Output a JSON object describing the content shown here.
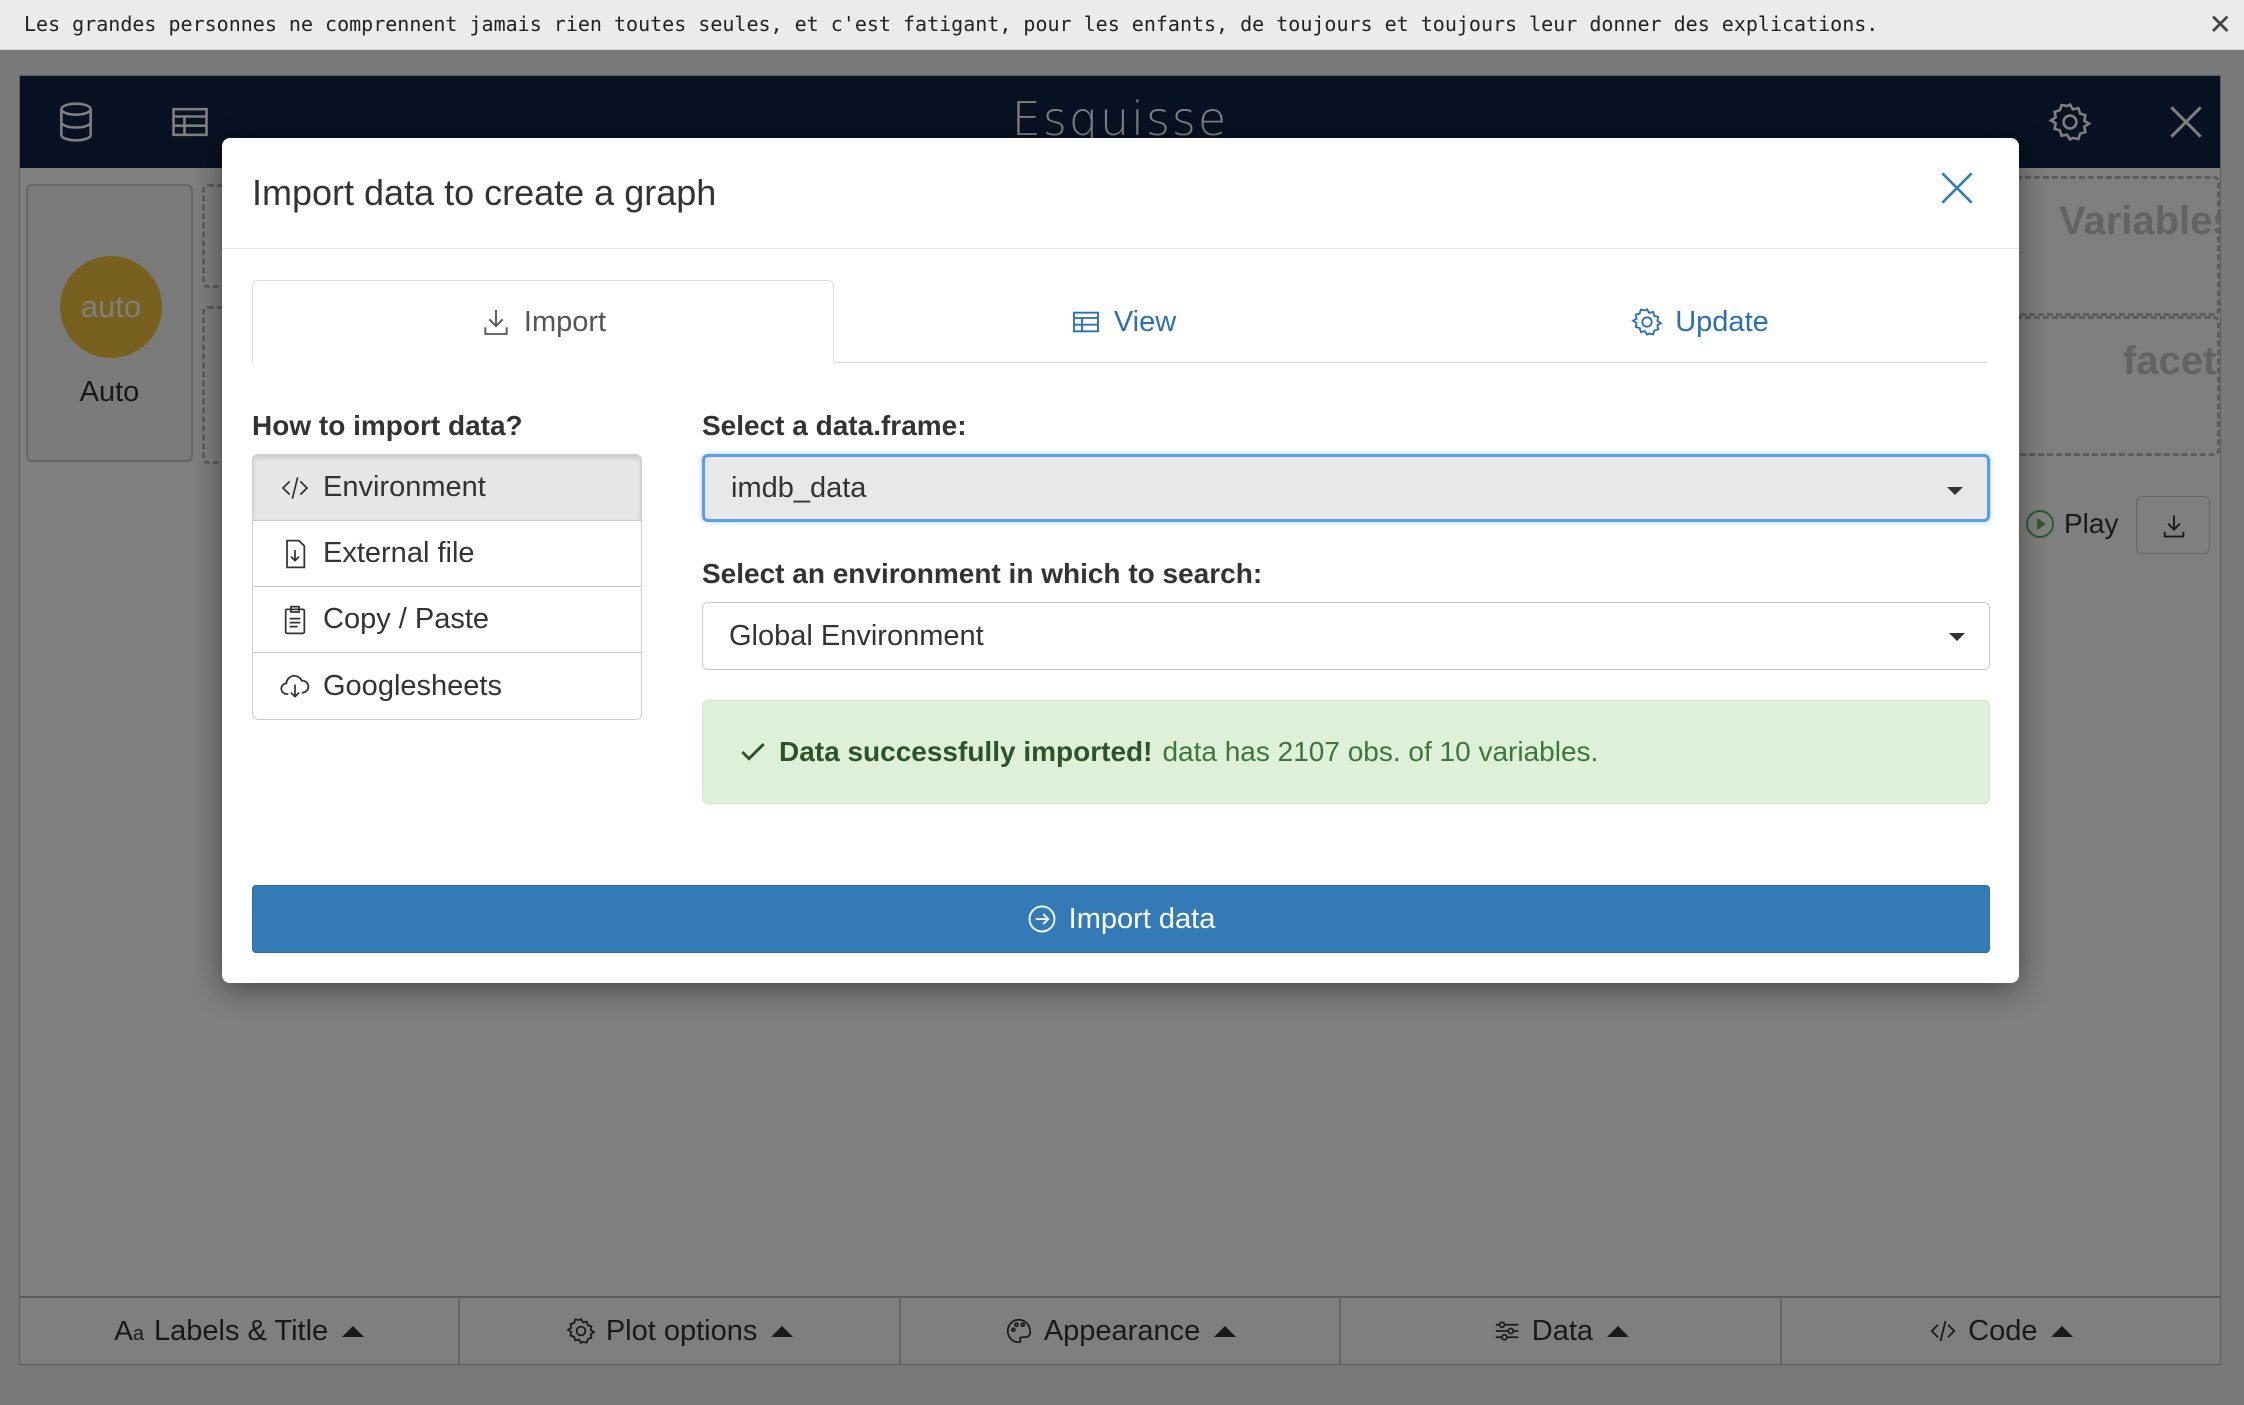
{
  "notice": {
    "text": "Les grandes personnes ne comprennent jamais rien toutes seules, et c'est fatigant, pour les enfants, de toujours et toujours leur donner des explications.",
    "close_glyph": "✕"
  },
  "app": {
    "title": "Esquisse",
    "geom_auto": {
      "circle": "auto",
      "label": "Auto"
    },
    "dropzones": {
      "variables": "Variables",
      "facet": "facet"
    },
    "play_label": "Play",
    "bottom_nav": [
      {
        "label": "Labels & Title",
        "icon": "font-icon"
      },
      {
        "label": "Plot options",
        "icon": "gear-icon"
      },
      {
        "label": "Appearance",
        "icon": "palette-icon"
      },
      {
        "label": "Data",
        "icon": "sliders-icon"
      },
      {
        "label": "Code",
        "icon": "code-icon"
      }
    ]
  },
  "modal": {
    "title": "Import data to create a graph",
    "tabs": [
      {
        "label": "Import",
        "active": true
      },
      {
        "label": "View",
        "active": false
      },
      {
        "label": "Update",
        "active": false
      }
    ],
    "how_label": "How to import data?",
    "methods": [
      {
        "label": "Environment",
        "active": true
      },
      {
        "label": "External file",
        "active": false
      },
      {
        "label": "Copy / Paste",
        "active": false
      },
      {
        "label": "Googlesheets",
        "active": false
      }
    ],
    "dataframe_label": "Select a data.frame:",
    "dataframe_value": "imdb_data",
    "env_label": "Select an environment in which to search:",
    "env_value": "Global Environment",
    "alert": {
      "strong": "Data successfully imported!",
      "text": "data has 2107 obs. of 10 variables."
    },
    "import_button": "Import data"
  },
  "colors": {
    "header_bg": "#112446",
    "primary": "#337ab7",
    "success_bg": "#dff0d8",
    "auto_yellow": "#f0c33c"
  }
}
